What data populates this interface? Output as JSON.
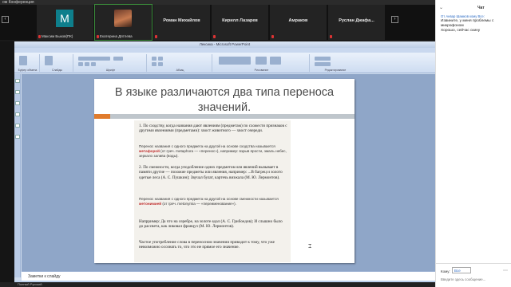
{
  "topbar": {
    "title": "ом Конференция"
  },
  "participants": [
    {
      "name": "",
      "caption": "Максим Быков(ПК)",
      "avatar_letter": "M",
      "type": "letter"
    },
    {
      "name": "",
      "caption": "Екатерина Дятлева",
      "type": "photo"
    },
    {
      "name": "Роман Михайлов",
      "caption": "",
      "type": "name"
    },
    {
      "name": "Кирилл Лазарев",
      "caption": "",
      "type": "name"
    },
    {
      "name": "Амраков",
      "caption": "",
      "type": "name"
    },
    {
      "name": "Руслан Джафа...",
      "caption": "",
      "type": "name"
    }
  ],
  "ppt": {
    "window_title": "Лексика - Microsoft PowerPoint",
    "tabs": [
      "Главная",
      "Вставка",
      "Дизайн",
      "Анимация",
      "Показ слайдов",
      "Рецензирование",
      "Вид"
    ],
    "groups": [
      "Буфер обмена",
      "Слайды",
      "Шрифт",
      "Абзац",
      "Рисование",
      "Редактирование"
    ],
    "notes_placeholder": "Заметки к слайду",
    "status": "Слайд 14 из 21"
  },
  "slide": {
    "title": "В языке различаются два типа переноса значений.",
    "scan_lines": [
      "1.  По сходству, когда названия дают явлениям (предметам) по схожести признаков с другими явлениями (предметами): хвост животного — хвост очереди.",
      "Перенос названия с одного предмета на другой на основе сходства называется метафорой (от греч. metaphora — «перенос»), например: взрыв ярости, эмаль небес, зеркало залива (воды).",
      "2.  По смежности, когда уподобление одних предметов или явлений вызывает в памяти другие — похожие предметы или явления, например: ...В багрец и золото одетые леса (А. С. Пушкин); Звучал булат, картечь визжала (М. Ю. Лермонтов).",
      "Перенос названия с одного предмета на другой на основе смежности называется метонимией (от греч. metonymia — «переименование»).",
      "Напрример: Да что на серебре, на золоте едал (А. С. Грибоедов); И слышно было до рассвета, как ликовал француз (М. Ю. Лермонтов).",
      "Частое употребление слова в переносном значении приводит к тому, что уже невозможно осознать то, что это не прямое его значение."
    ],
    "highlight_1": "метафорой",
    "highlight_2": "метонимией"
  },
  "bottombar": {
    "text": "Полный Русский"
  },
  "chat": {
    "title": "Чат",
    "meta": "От Анвар Шамков кому Все:",
    "messages": [
      "Извините, у меня проблемы с микрофоном",
      "Хорошо, сейчас скину"
    ],
    "to_label": "Кому:",
    "to_value": "Все",
    "input_placeholder": "Введите здесь сообщение..."
  },
  "colors": {
    "accent_orange": "#e07b2c",
    "zoom_teal": "#0e7f8c",
    "link_blue": "#2d6cc4"
  }
}
